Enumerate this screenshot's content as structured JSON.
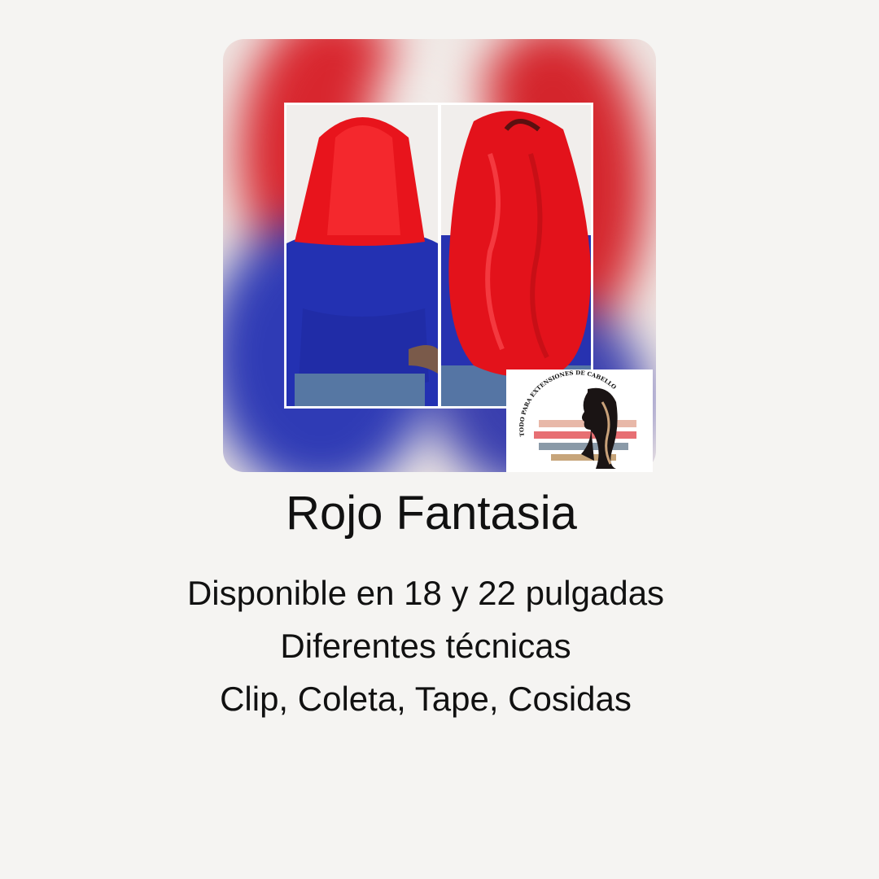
{
  "hero": {
    "before_photo": "red-straight-hair-before-photo",
    "after_photo": "red-wavy-hair-extensions-after-photo",
    "logo_text": "TODO PARA EXTENSIONES DE CABELLO"
  },
  "colors": {
    "background": "#f5f4f2",
    "hair_red": "#e3161d",
    "shirt_blue": "#2b33b3",
    "text": "#111111"
  },
  "product": {
    "title": "Rojo Fantasia",
    "lines": [
      "Disponible en 18 y 22 pulgadas",
      "Diferentes técnicas",
      "Clip, Coleta, Tape, Cosidas"
    ]
  }
}
